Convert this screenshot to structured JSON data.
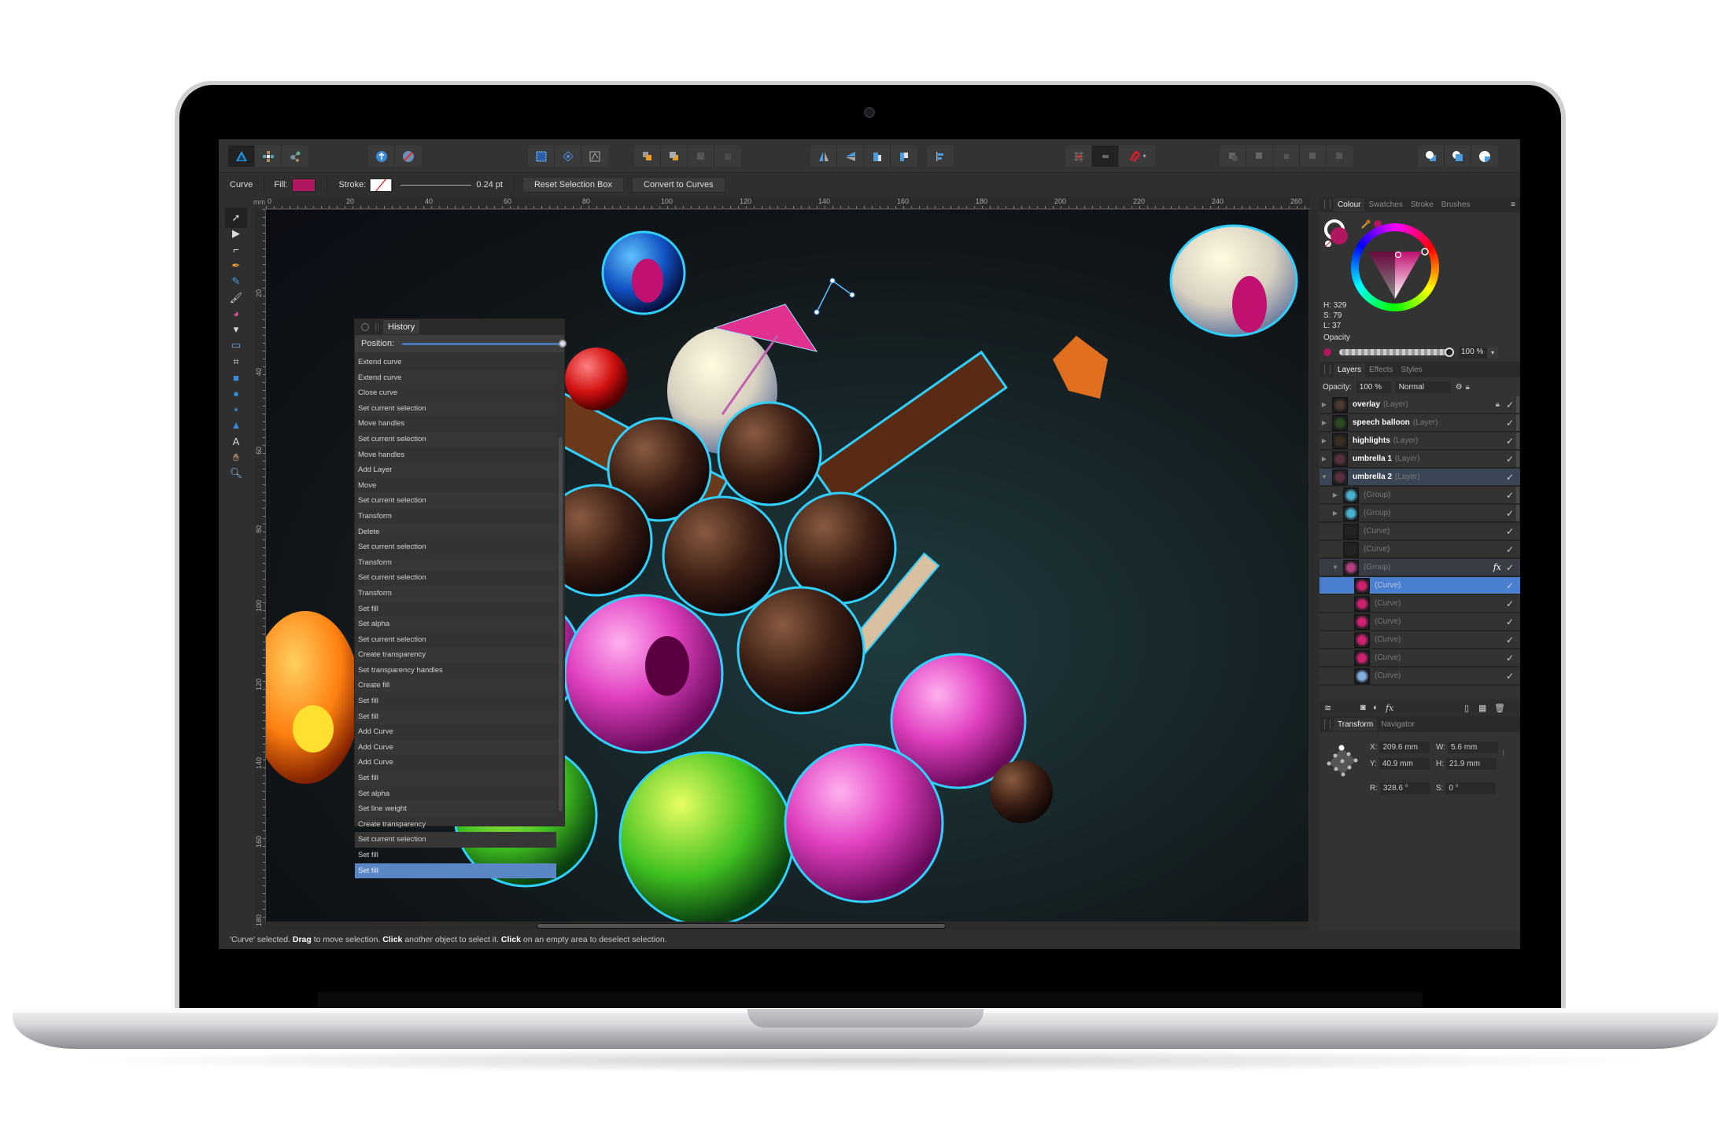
{
  "app": {
    "name": "Affinity Designer"
  },
  "toolbar": {
    "groups": [
      {
        "buttons": [
          "designer-persona-icon",
          "pixel-persona-icon",
          "export-persona-icon"
        ]
      },
      {
        "buttons": [
          "move-to-front-icon",
          "snap-off-icon"
        ]
      },
      {
        "buttons": [
          "grid-select-icon",
          "transform-origin-icon",
          "node-select-icon"
        ]
      },
      {
        "buttons": [
          "arrange-forward-icon",
          "arrange-backward-icon",
          "arrange-top-icon",
          "arrange-bottom-icon"
        ]
      },
      {
        "buttons": [
          "flip-horizontal-icon",
          "flip-vertical-icon",
          "rotate-left-icon",
          "rotate-right-icon"
        ]
      },
      {
        "buttons": [
          "align-left-icon"
        ]
      },
      {
        "buttons": [
          "snapping-grid-icon",
          "snapping-options-icon",
          "magnet-icon"
        ]
      },
      {
        "buttons": [
          "boolean-add-icon",
          "boolean-subtract-icon",
          "boolean-intersect-icon",
          "boolean-xor-icon",
          "boolean-divide-icon"
        ]
      },
      {
        "buttons": [
          "insert-behind-icon",
          "insert-top-icon",
          "insert-inside-icon"
        ]
      }
    ]
  },
  "context": {
    "object_type": "Curve",
    "fill_label": "Fill:",
    "fill_color": "#b0175e",
    "stroke_label": "Stroke:",
    "stroke_width": "0.24 pt",
    "reset_button": "Reset Selection Box",
    "convert_button": "Convert to Curves"
  },
  "ruler": {
    "unit": "mm",
    "h_ticks": [
      "0",
      "20",
      "40",
      "60",
      "80",
      "100",
      "120",
      "140",
      "160",
      "180",
      "200",
      "220",
      "240",
      "260"
    ],
    "v_ticks": [
      "20",
      "40",
      "60",
      "80",
      "100",
      "120",
      "140",
      "160",
      "180"
    ]
  },
  "tools": [
    "move-tool-icon",
    "node-tool-icon",
    "corner-tool-icon",
    "pen-tool-icon",
    "pencil-tool-icon",
    "vector-brush-icon",
    "fill-tool-icon",
    "transparency-tool-icon",
    "place-image-icon",
    "crop-tool-icon",
    "rectangle-tool-icon",
    "ellipse-tool-icon",
    "rounded-rect-tool-icon",
    "triangle-tool-icon",
    "text-tool-icon",
    "hand-tool-icon",
    "zoom-tool-icon"
  ],
  "history": {
    "title": "History",
    "position_label": "Position:",
    "position_value": 1.0,
    "items": [
      "Extend curve",
      "Extend curve",
      "Close curve",
      "Set current selection",
      "Move handles",
      "Set current selection",
      "Move handles",
      "Add Layer",
      "Move",
      "Set current selection",
      "Transform",
      "Delete",
      "Set current selection",
      "Transform",
      "Set current selection",
      "Transform",
      "Set fill",
      "Set alpha",
      "Set current selection",
      "Create transparency",
      "Set transparency handles",
      "Create fill",
      "Set fill",
      "Set fill",
      "Add Curve",
      "Add Curve",
      "Add Curve",
      "Set fill",
      "Set alpha",
      "Set line weight",
      "Create transparency",
      "Set current selection",
      "Set fill",
      "Set fill"
    ],
    "selected_index": 33
  },
  "colour_panel": {
    "tabs": [
      "Colour",
      "Swatches",
      "Stroke",
      "Brushes"
    ],
    "active_tab": "Colour",
    "h": "H: 329",
    "s": "S: 79",
    "l": "L: 37",
    "opacity_label": "Opacity",
    "opacity_value": "100 %",
    "color": "#b0175e"
  },
  "layers_panel": {
    "tabs": [
      "Layers",
      "Effects",
      "Styles"
    ],
    "active_tab": "Layers",
    "opacity_label": "Opacity:",
    "opacity_value": "100 %",
    "blend_mode": "Normal",
    "layers": [
      {
        "name": "overlay",
        "type": "(Layer)",
        "expand": "▶",
        "locked": true,
        "visible": true,
        "indent": 0
      },
      {
        "name": "speech balloon",
        "type": "(Layer)",
        "expand": "▶",
        "visible": true,
        "indent": 0
      },
      {
        "name": "highlights",
        "type": "(Layer)",
        "expand": "▶",
        "visible": true,
        "indent": 0
      },
      {
        "name": "umbrella 1",
        "type": "(Layer)",
        "expand": "▶",
        "visible": true,
        "indent": 0
      },
      {
        "name": "umbrella 2",
        "type": "(Layer)",
        "expand": "▼",
        "visible": true,
        "indent": 0,
        "highlight": true
      },
      {
        "name": "",
        "type": "(Group)",
        "expand": "▶",
        "visible": true,
        "indent": 1
      },
      {
        "name": "",
        "type": "(Group)",
        "expand": "▶",
        "visible": true,
        "indent": 1
      },
      {
        "name": "",
        "type": "(Curve)",
        "expand": "",
        "visible": true,
        "indent": 1
      },
      {
        "name": "",
        "type": "(Curve)",
        "expand": "",
        "visible": true,
        "indent": 1
      },
      {
        "name": "",
        "type": "(Group)",
        "expand": "▼",
        "visible": true,
        "indent": 1,
        "fx": true,
        "group": true
      },
      {
        "name": "",
        "type": "(Curve)",
        "expand": "",
        "visible": true,
        "indent": 2,
        "selected": true
      },
      {
        "name": "",
        "type": "(Curve)",
        "expand": "",
        "visible": true,
        "indent": 2
      },
      {
        "name": "",
        "type": "(Curve)",
        "expand": "",
        "visible": true,
        "indent": 2
      },
      {
        "name": "",
        "type": "(Curve)",
        "expand": "",
        "visible": true,
        "indent": 2
      },
      {
        "name": "",
        "type": "(Curve)",
        "expand": "",
        "visible": true,
        "indent": 2
      },
      {
        "name": "",
        "type": "(Curve)",
        "expand": "",
        "visible": true,
        "indent": 2
      }
    ]
  },
  "transform_panel": {
    "tabs": [
      "Transform",
      "Navigator"
    ],
    "active_tab": "Transform",
    "x": "209.6 mm",
    "y": "40.9 mm",
    "w": "5.6 mm",
    "h": "21.9 mm",
    "r": "328.6 °",
    "s": "0 °"
  },
  "status": {
    "part1": "'Curve' selected. ",
    "b1": "Drag",
    "part2": " to move selection. ",
    "b2": "Click",
    "part3": " another object to select it. ",
    "b3": "Click",
    "part4": " on an empty area to deselect selection."
  }
}
